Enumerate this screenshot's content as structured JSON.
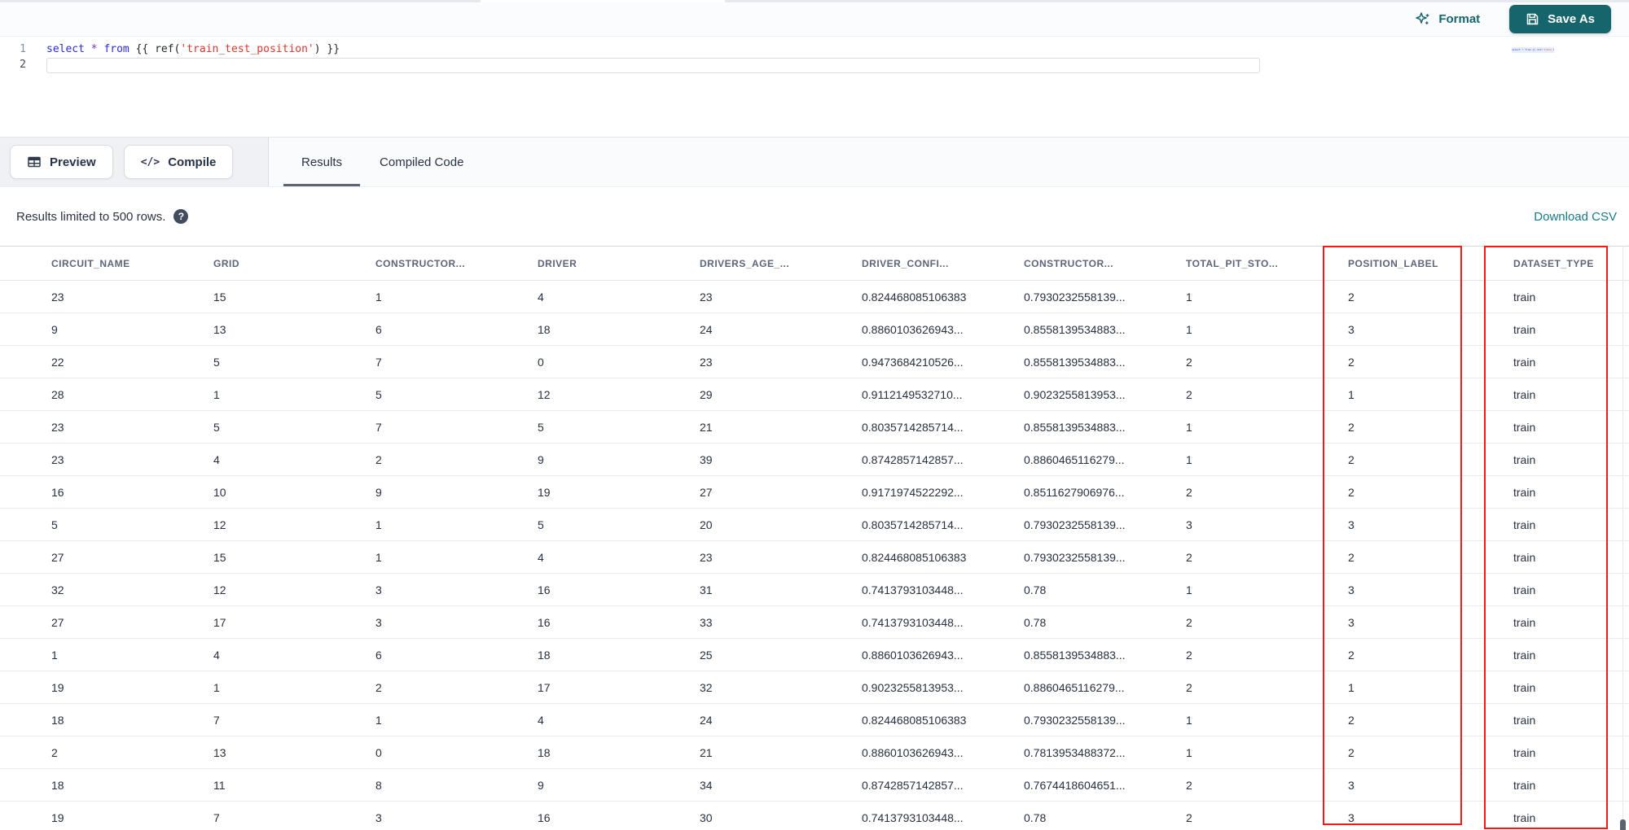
{
  "top": {
    "format_label": "Format",
    "save_as_label": "Save As"
  },
  "editor": {
    "lines": [
      {
        "num": "1"
      },
      {
        "num": "2"
      }
    ],
    "tokens": [
      {
        "t": "select"
      },
      {
        "t": " "
      },
      {
        "t": "*"
      },
      {
        "t": " "
      },
      {
        "t": "from"
      },
      {
        "t": " {{ "
      },
      {
        "t": "ref("
      },
      {
        "t": "'train_test_position'"
      },
      {
        "t": ") }}"
      }
    ],
    "minimap": {
      "p1": "select * from {{ ref(",
      "p2": "'train_test_position'",
      "p3": ") }}"
    }
  },
  "actions": {
    "preview_label": "Preview",
    "compile_label": "Compile",
    "compile_glyph": "</>"
  },
  "tabs": [
    {
      "label": "Results"
    },
    {
      "label": "Compiled Code"
    }
  ],
  "results_bar": {
    "limit_text": "Results limited to 500 rows.",
    "help_glyph": "?",
    "download_label": "Download CSV"
  },
  "table": {
    "columns": [
      "CIRCUIT_NAME",
      "GRID",
      "CONSTRUCTOR...",
      "DRIVER",
      "DRIVERS_AGE_...",
      "DRIVER_CONFI...",
      "CONSTRUCTOR...",
      "TOTAL_PIT_STO...",
      "POSITION_LABEL",
      "DATASET_TYPE"
    ],
    "rows": [
      [
        "23",
        "15",
        "1",
        "4",
        "23",
        "0.824468085106383",
        "0.7930232558139...",
        "1",
        "2",
        "train"
      ],
      [
        "9",
        "13",
        "6",
        "18",
        "24",
        "0.8860103626943...",
        "0.8558139534883...",
        "1",
        "3",
        "train"
      ],
      [
        "22",
        "5",
        "7",
        "0",
        "23",
        "0.9473684210526...",
        "0.8558139534883...",
        "2",
        "2",
        "train"
      ],
      [
        "28",
        "1",
        "5",
        "12",
        "29",
        "0.9112149532710...",
        "0.9023255813953...",
        "2",
        "1",
        "train"
      ],
      [
        "23",
        "5",
        "7",
        "5",
        "21",
        "0.8035714285714...",
        "0.8558139534883...",
        "1",
        "2",
        "train"
      ],
      [
        "23",
        "4",
        "2",
        "9",
        "39",
        "0.8742857142857...",
        "0.8860465116279...",
        "1",
        "2",
        "train"
      ],
      [
        "16",
        "10",
        "9",
        "19",
        "27",
        "0.9171974522292...",
        "0.8511627906976...",
        "2",
        "2",
        "train"
      ],
      [
        "5",
        "12",
        "1",
        "5",
        "20",
        "0.8035714285714...",
        "0.7930232558139...",
        "3",
        "3",
        "train"
      ],
      [
        "27",
        "15",
        "1",
        "4",
        "23",
        "0.824468085106383",
        "0.7930232558139...",
        "2",
        "2",
        "train"
      ],
      [
        "32",
        "12",
        "3",
        "16",
        "31",
        "0.7413793103448...",
        "0.78",
        "1",
        "3",
        "train"
      ],
      [
        "27",
        "17",
        "3",
        "16",
        "33",
        "0.7413793103448...",
        "0.78",
        "2",
        "3",
        "train"
      ],
      [
        "1",
        "4",
        "6",
        "18",
        "25",
        "0.8860103626943...",
        "0.8558139534883...",
        "2",
        "2",
        "train"
      ],
      [
        "19",
        "1",
        "2",
        "17",
        "32",
        "0.9023255813953...",
        "0.8860465116279...",
        "2",
        "1",
        "train"
      ],
      [
        "18",
        "7",
        "1",
        "4",
        "24",
        "0.824468085106383",
        "0.7930232558139...",
        "1",
        "2",
        "train"
      ],
      [
        "2",
        "13",
        "0",
        "18",
        "21",
        "0.8860103626943...",
        "0.7813953488372...",
        "1",
        "2",
        "train"
      ],
      [
        "18",
        "11",
        "8",
        "9",
        "34",
        "0.8742857142857...",
        "0.7674418604651...",
        "2",
        "3",
        "train"
      ],
      [
        "19",
        "7",
        "3",
        "16",
        "30",
        "0.7413793103448...",
        "0.78",
        "2",
        "3",
        "train"
      ]
    ]
  },
  "colors": {
    "accent": "#17656c",
    "link": "#187a87",
    "highlight_red": "#ee1c16"
  }
}
